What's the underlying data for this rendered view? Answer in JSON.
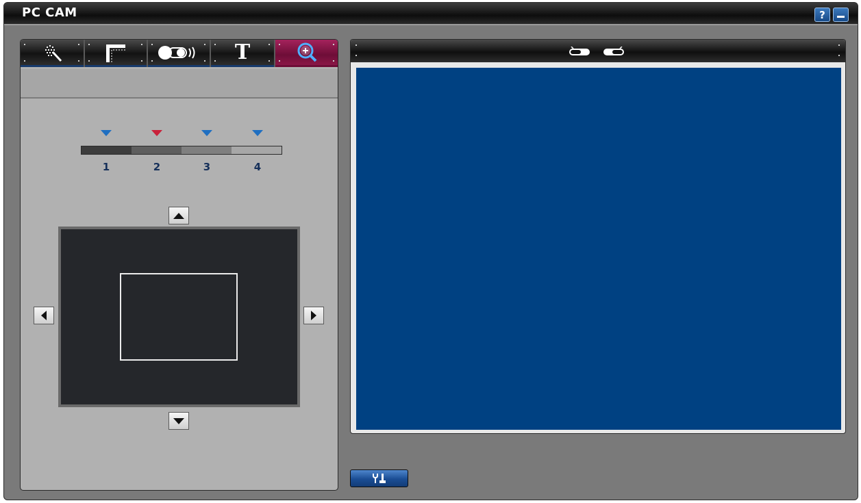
{
  "window": {
    "title": "PC CAM",
    "help_label": "?",
    "colors": {
      "chrome": "#0d0d0d",
      "panel": "#b1b1b1",
      "video": "#004182",
      "active_tab": "#8a1747",
      "accent": "#1f6fc1"
    }
  },
  "tabs": [
    {
      "name": "effects",
      "icon": "sparkle-wand-icon",
      "active": false
    },
    {
      "name": "frame",
      "icon": "frame-corner-icon",
      "active": false
    },
    {
      "name": "toggle",
      "icon": "light-toggle-icon",
      "active": false
    },
    {
      "name": "text",
      "icon": "text-icon",
      "label": "T",
      "active": false
    },
    {
      "name": "zoom",
      "icon": "zoom-in-icon",
      "active": true
    }
  ],
  "zoom": {
    "levels": [
      "1",
      "2",
      "3",
      "4"
    ],
    "selected_level": "2"
  },
  "pan": {
    "up_icon": "arrow-up-icon",
    "down_icon": "arrow-down-icon",
    "left_icon": "arrow-left-icon",
    "right_icon": "arrow-right-icon"
  },
  "preview": {
    "header_icons": [
      "switch-left-icon",
      "switch-right-icon"
    ]
  },
  "settings": {
    "icon": "tools-icon"
  }
}
